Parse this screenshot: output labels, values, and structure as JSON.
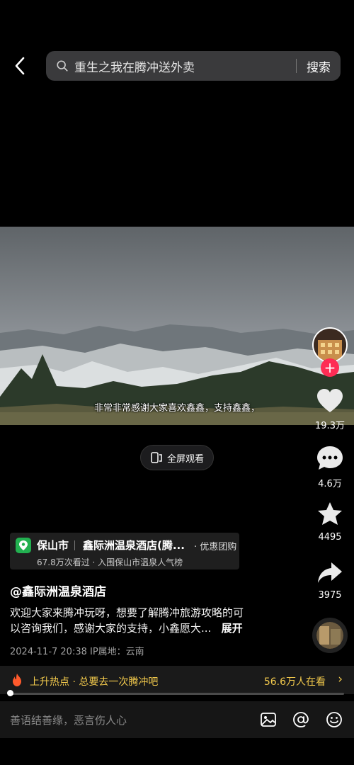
{
  "search": {
    "query": "重生之我在腾冲送外卖",
    "button": "搜索"
  },
  "video": {
    "subtitle": "非常非常感谢大家喜欢鑫鑫，支持鑫鑫，",
    "fullscreen_label": "全屏观看"
  },
  "rail": {
    "likes": "19.3万",
    "comments": "4.6万",
    "favorites": "4495",
    "shares": "3975"
  },
  "location": {
    "city": "保山市",
    "name": "鑫际洲温泉酒店(腾...",
    "group_buy": "· 优惠团购",
    "stats": "67.8万次看过 · 入围保山市温泉人气榜"
  },
  "post": {
    "author": "@鑫际洲温泉酒店",
    "description_line1": "欢迎大家来腾冲玩呀，想要了解腾冲旅游攻略的可",
    "description_line2": "以咨询我们，感谢大家的支持，小鑫愿大...",
    "expand": "展开",
    "meta": "2024-11-7 20:38   IP属地：云南"
  },
  "hot": {
    "text": "上升热点 · 总要去一次腾冲吧",
    "watching": "56.6万人在看",
    "progress": 0.01
  },
  "comment_bar": {
    "placeholder": "善语结善缘，恶言伤人心"
  },
  "colors": {
    "accent": "#fe2c55",
    "hot": "#f2c94c",
    "location_pin": "#22b050"
  }
}
